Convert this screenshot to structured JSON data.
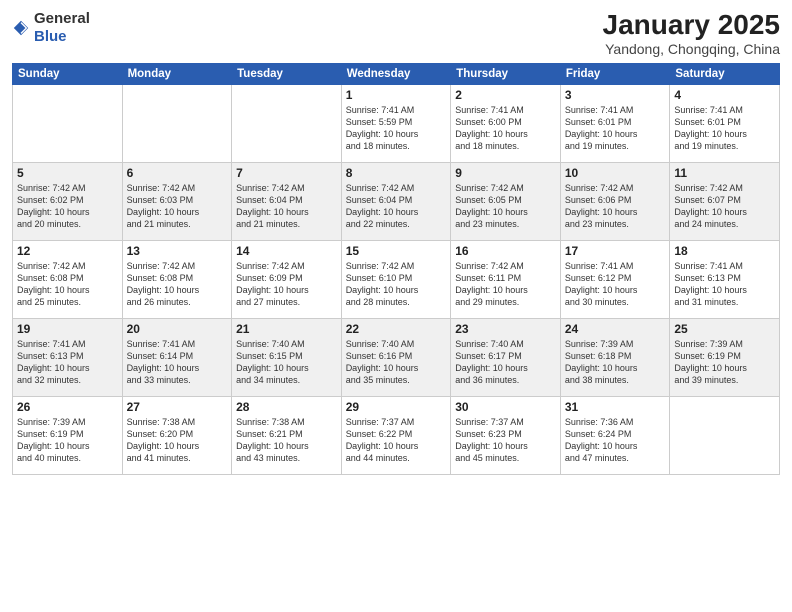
{
  "header": {
    "logo_general": "General",
    "logo_blue": "Blue",
    "title": "January 2025",
    "location": "Yandong, Chongqing, China"
  },
  "weekdays": [
    "Sunday",
    "Monday",
    "Tuesday",
    "Wednesday",
    "Thursday",
    "Friday",
    "Saturday"
  ],
  "weeks": [
    [
      {
        "day": "",
        "info": "",
        "empty": true,
        "gray": false
      },
      {
        "day": "",
        "info": "",
        "empty": true,
        "gray": false
      },
      {
        "day": "",
        "info": "",
        "empty": true,
        "gray": false
      },
      {
        "day": "1",
        "info": "Sunrise: 7:41 AM\nSunset: 5:59 PM\nDaylight: 10 hours\nand 18 minutes.",
        "empty": false,
        "gray": false
      },
      {
        "day": "2",
        "info": "Sunrise: 7:41 AM\nSunset: 6:00 PM\nDaylight: 10 hours\nand 18 minutes.",
        "empty": false,
        "gray": false
      },
      {
        "day": "3",
        "info": "Sunrise: 7:41 AM\nSunset: 6:01 PM\nDaylight: 10 hours\nand 19 minutes.",
        "empty": false,
        "gray": false
      },
      {
        "day": "4",
        "info": "Sunrise: 7:41 AM\nSunset: 6:01 PM\nDaylight: 10 hours\nand 19 minutes.",
        "empty": false,
        "gray": false
      }
    ],
    [
      {
        "day": "5",
        "info": "Sunrise: 7:42 AM\nSunset: 6:02 PM\nDaylight: 10 hours\nand 20 minutes.",
        "empty": false,
        "gray": true
      },
      {
        "day": "6",
        "info": "Sunrise: 7:42 AM\nSunset: 6:03 PM\nDaylight: 10 hours\nand 21 minutes.",
        "empty": false,
        "gray": true
      },
      {
        "day": "7",
        "info": "Sunrise: 7:42 AM\nSunset: 6:04 PM\nDaylight: 10 hours\nand 21 minutes.",
        "empty": false,
        "gray": true
      },
      {
        "day": "8",
        "info": "Sunrise: 7:42 AM\nSunset: 6:04 PM\nDaylight: 10 hours\nand 22 minutes.",
        "empty": false,
        "gray": true
      },
      {
        "day": "9",
        "info": "Sunrise: 7:42 AM\nSunset: 6:05 PM\nDaylight: 10 hours\nand 23 minutes.",
        "empty": false,
        "gray": true
      },
      {
        "day": "10",
        "info": "Sunrise: 7:42 AM\nSunset: 6:06 PM\nDaylight: 10 hours\nand 23 minutes.",
        "empty": false,
        "gray": true
      },
      {
        "day": "11",
        "info": "Sunrise: 7:42 AM\nSunset: 6:07 PM\nDaylight: 10 hours\nand 24 minutes.",
        "empty": false,
        "gray": true
      }
    ],
    [
      {
        "day": "12",
        "info": "Sunrise: 7:42 AM\nSunset: 6:08 PM\nDaylight: 10 hours\nand 25 minutes.",
        "empty": false,
        "gray": false
      },
      {
        "day": "13",
        "info": "Sunrise: 7:42 AM\nSunset: 6:08 PM\nDaylight: 10 hours\nand 26 minutes.",
        "empty": false,
        "gray": false
      },
      {
        "day": "14",
        "info": "Sunrise: 7:42 AM\nSunset: 6:09 PM\nDaylight: 10 hours\nand 27 minutes.",
        "empty": false,
        "gray": false
      },
      {
        "day": "15",
        "info": "Sunrise: 7:42 AM\nSunset: 6:10 PM\nDaylight: 10 hours\nand 28 minutes.",
        "empty": false,
        "gray": false
      },
      {
        "day": "16",
        "info": "Sunrise: 7:42 AM\nSunset: 6:11 PM\nDaylight: 10 hours\nand 29 minutes.",
        "empty": false,
        "gray": false
      },
      {
        "day": "17",
        "info": "Sunrise: 7:41 AM\nSunset: 6:12 PM\nDaylight: 10 hours\nand 30 minutes.",
        "empty": false,
        "gray": false
      },
      {
        "day": "18",
        "info": "Sunrise: 7:41 AM\nSunset: 6:13 PM\nDaylight: 10 hours\nand 31 minutes.",
        "empty": false,
        "gray": false
      }
    ],
    [
      {
        "day": "19",
        "info": "Sunrise: 7:41 AM\nSunset: 6:13 PM\nDaylight: 10 hours\nand 32 minutes.",
        "empty": false,
        "gray": true
      },
      {
        "day": "20",
        "info": "Sunrise: 7:41 AM\nSunset: 6:14 PM\nDaylight: 10 hours\nand 33 minutes.",
        "empty": false,
        "gray": true
      },
      {
        "day": "21",
        "info": "Sunrise: 7:40 AM\nSunset: 6:15 PM\nDaylight: 10 hours\nand 34 minutes.",
        "empty": false,
        "gray": true
      },
      {
        "day": "22",
        "info": "Sunrise: 7:40 AM\nSunset: 6:16 PM\nDaylight: 10 hours\nand 35 minutes.",
        "empty": false,
        "gray": true
      },
      {
        "day": "23",
        "info": "Sunrise: 7:40 AM\nSunset: 6:17 PM\nDaylight: 10 hours\nand 36 minutes.",
        "empty": false,
        "gray": true
      },
      {
        "day": "24",
        "info": "Sunrise: 7:39 AM\nSunset: 6:18 PM\nDaylight: 10 hours\nand 38 minutes.",
        "empty": false,
        "gray": true
      },
      {
        "day": "25",
        "info": "Sunrise: 7:39 AM\nSunset: 6:19 PM\nDaylight: 10 hours\nand 39 minutes.",
        "empty": false,
        "gray": true
      }
    ],
    [
      {
        "day": "26",
        "info": "Sunrise: 7:39 AM\nSunset: 6:19 PM\nDaylight: 10 hours\nand 40 minutes.",
        "empty": false,
        "gray": false
      },
      {
        "day": "27",
        "info": "Sunrise: 7:38 AM\nSunset: 6:20 PM\nDaylight: 10 hours\nand 41 minutes.",
        "empty": false,
        "gray": false
      },
      {
        "day": "28",
        "info": "Sunrise: 7:38 AM\nSunset: 6:21 PM\nDaylight: 10 hours\nand 43 minutes.",
        "empty": false,
        "gray": false
      },
      {
        "day": "29",
        "info": "Sunrise: 7:37 AM\nSunset: 6:22 PM\nDaylight: 10 hours\nand 44 minutes.",
        "empty": false,
        "gray": false
      },
      {
        "day": "30",
        "info": "Sunrise: 7:37 AM\nSunset: 6:23 PM\nDaylight: 10 hours\nand 45 minutes.",
        "empty": false,
        "gray": false
      },
      {
        "day": "31",
        "info": "Sunrise: 7:36 AM\nSunset: 6:24 PM\nDaylight: 10 hours\nand 47 minutes.",
        "empty": false,
        "gray": false
      },
      {
        "day": "",
        "info": "",
        "empty": true,
        "gray": false
      }
    ]
  ]
}
